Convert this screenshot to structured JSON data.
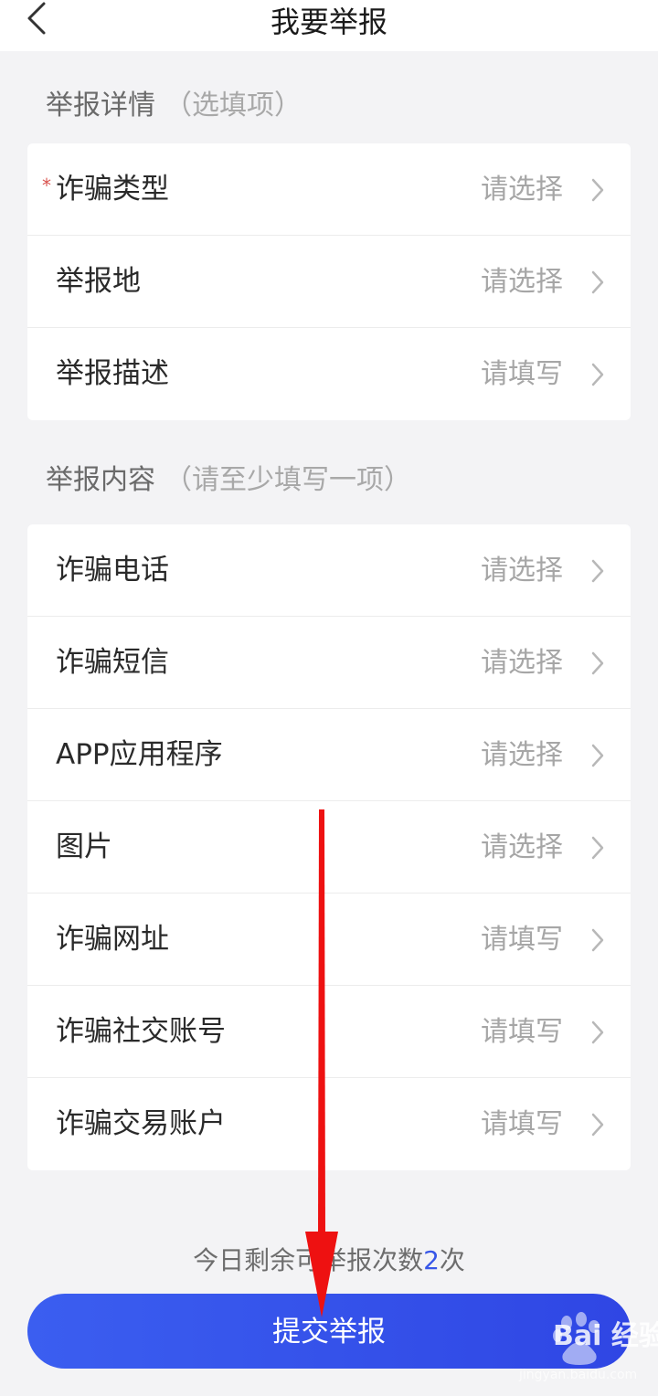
{
  "header": {
    "title": "我要举报",
    "back_icon": "chevron-left-icon"
  },
  "details_section": {
    "title": "举报详情",
    "hint": "（选填项）",
    "rows": [
      {
        "label": "诈骗类型",
        "value": "请选择",
        "required": true
      },
      {
        "label": "举报地",
        "value": "请选择"
      },
      {
        "label": "举报描述",
        "value": "请填写"
      }
    ]
  },
  "content_section": {
    "title": "举报内容",
    "hint": "（请至少填写一项）",
    "rows": [
      {
        "label": "诈骗电话",
        "value": "请选择"
      },
      {
        "label": "诈骗短信",
        "value": "请选择"
      },
      {
        "label": "APP应用程序",
        "value": "请选择"
      },
      {
        "label": "图片",
        "value": "请选择"
      },
      {
        "label": "诈骗网址",
        "value": "请填写"
      },
      {
        "label": "诈骗社交账号",
        "value": "请填写"
      },
      {
        "label": "诈骗交易账户",
        "value": "请填写"
      }
    ]
  },
  "footer": {
    "remaining_prefix": "今日剩余可举报次数",
    "remaining_count": "2",
    "remaining_suffix": "次",
    "submit_label": "提交举报"
  },
  "watermark": {
    "text": "Bai 经验",
    "url": "jingyan.baidu.com"
  },
  "colors": {
    "accent": "#3b5ef0",
    "required": "#d9534f",
    "annotation": "#ee1111"
  }
}
